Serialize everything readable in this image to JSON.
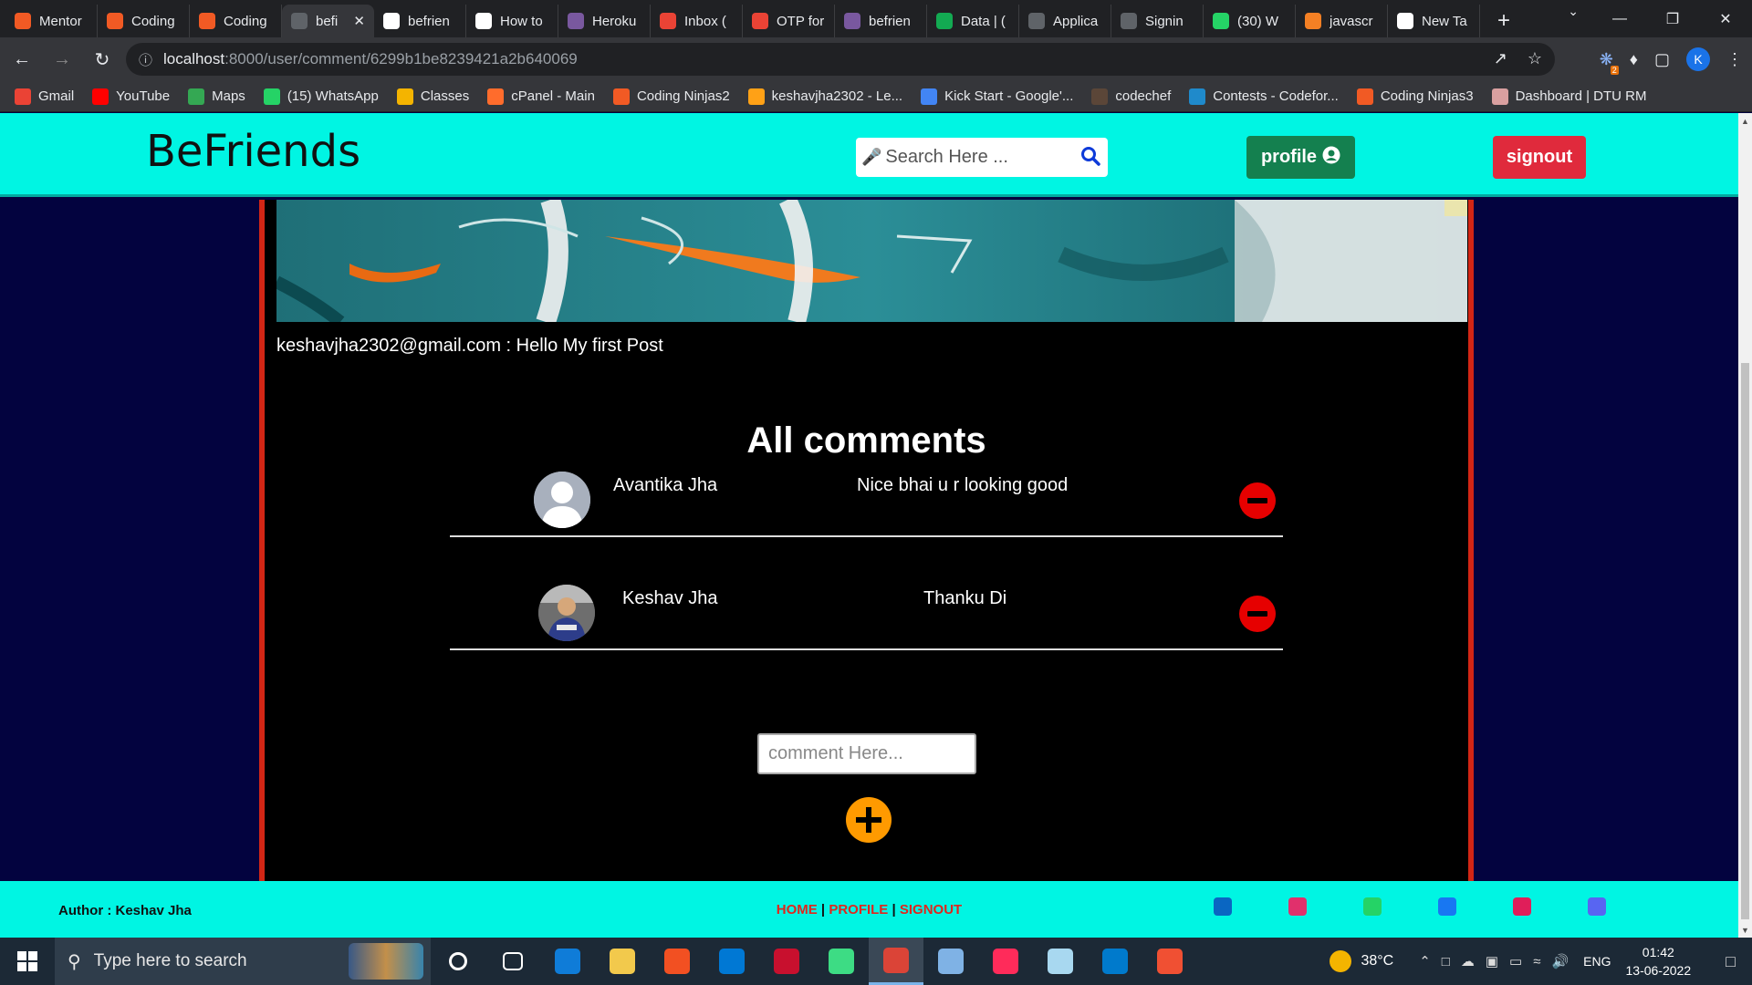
{
  "browser": {
    "tabs": [
      {
        "title": "Mentor",
        "icon": "coding-ninjas-icon",
        "color": "#f15a24"
      },
      {
        "title": "Coding",
        "icon": "coding-ninjas-icon",
        "color": "#f15a24"
      },
      {
        "title": "Coding",
        "icon": "coding-ninjas-icon",
        "color": "#f15a24"
      },
      {
        "title": "befi",
        "icon": "globe-icon",
        "color": "#5f6368",
        "active": true
      },
      {
        "title": "befrien",
        "icon": "github-icon",
        "color": "#ffffff"
      },
      {
        "title": "How to",
        "icon": "medium-icon",
        "color": "#ffffff"
      },
      {
        "title": "Heroku",
        "icon": "heroku-icon",
        "color": "#79589f"
      },
      {
        "title": "Inbox (",
        "icon": "gmail-icon",
        "color": "#ea4335"
      },
      {
        "title": "OTP for",
        "icon": "gmail-icon",
        "color": "#ea4335"
      },
      {
        "title": "befrien",
        "icon": "heroku-icon",
        "color": "#79589f"
      },
      {
        "title": "Data | (",
        "icon": "mongodb-icon",
        "color": "#13aa52"
      },
      {
        "title": "Applica",
        "icon": "globe-icon",
        "color": "#5f6368"
      },
      {
        "title": "Signin",
        "icon": "globe-icon",
        "color": "#5f6368"
      },
      {
        "title": "(30) W",
        "icon": "whatsapp-icon",
        "color": "#25d366"
      },
      {
        "title": "javascr",
        "icon": "stackoverflow-icon",
        "color": "#f48024"
      },
      {
        "title": "New Ta",
        "icon": "chrome-icon",
        "color": "#ffffff"
      }
    ],
    "url_host": "localhost",
    "url_path": ":8000/user/comment/6299b1be8239421a2b640069",
    "profile_initial": "K",
    "extension_badge": "2",
    "bookmarks": [
      {
        "label": "Gmail",
        "icon": "gmail-icon",
        "color": "#ea4335"
      },
      {
        "label": "YouTube",
        "icon": "youtube-icon",
        "color": "#ff0000"
      },
      {
        "label": "Maps",
        "icon": "maps-icon",
        "color": "#34a853"
      },
      {
        "label": "(15) WhatsApp",
        "icon": "whatsapp-icon",
        "color": "#25d366"
      },
      {
        "label": "Classes",
        "icon": "classroom-icon",
        "color": "#f4b400"
      },
      {
        "label": "cPanel - Main",
        "icon": "cpanel-icon",
        "color": "#ff6c2c"
      },
      {
        "label": "Coding Ninjas2",
        "icon": "coding-ninjas-icon",
        "color": "#f15a24"
      },
      {
        "label": "keshavjha2302 - Le...",
        "icon": "leetcode-icon",
        "color": "#ffa116"
      },
      {
        "label": "Kick Start - Google'...",
        "icon": "google-icon",
        "color": "#4285f4"
      },
      {
        "label": "codechef",
        "icon": "codechef-icon",
        "color": "#5b4638"
      },
      {
        "label": "Contests - Codefor...",
        "icon": "codeforces-icon",
        "color": "#1f8acb"
      },
      {
        "label": "Coding Ninjas3",
        "icon": "coding-ninjas-icon",
        "color": "#f15a24"
      },
      {
        "label": "Dashboard | DTU RM",
        "icon": "dtu-icon",
        "color": "#d9a0a0"
      }
    ]
  },
  "site": {
    "brand": "BeFriends",
    "search_placeholder": "Search Here ...",
    "profile_label": "profile",
    "signout_label": "signout",
    "post_caption": "keshavjha2302@gmail.com : Hello My first Post",
    "comments_title": "All comments",
    "comments": [
      {
        "name": "Avantika Jha",
        "text": "Nice bhai u r looking good",
        "avatar": "default-user-avatar"
      },
      {
        "name": "Keshav Jha",
        "text": "Thanku Di",
        "avatar": "user-photo-avatar"
      }
    ],
    "comment_placeholder": "comment Here...",
    "footer_author": "Author : Keshav Jha",
    "footer_links": [
      "HOME",
      "PROFILE",
      "SIGNOUT"
    ],
    "footer_separator": " | ",
    "socials": [
      {
        "icon": "linkedin-icon",
        "color": "#0a66c2"
      },
      {
        "icon": "instagram-icon",
        "color": "#e1306c"
      },
      {
        "icon": "whatsapp-icon",
        "color": "#25d366"
      },
      {
        "icon": "facebook-icon",
        "color": "#1877f2"
      },
      {
        "icon": "slack-icon",
        "color": "#e01e5a"
      },
      {
        "icon": "discord-icon",
        "color": "#5865f2"
      }
    ],
    "colors": {
      "navbar": "#00f5e3",
      "page_bg": "#03033f",
      "card_border": "#d22615",
      "profile_btn": "#14804f",
      "signout_btn": "#e02a3c",
      "delete_btn": "#e60000",
      "add_btn": "#ff9a00"
    }
  },
  "taskbar": {
    "search_placeholder": "Type here to search",
    "apps": [
      {
        "icon": "cortana-icon",
        "color": "#1c2936"
      },
      {
        "icon": "task-view-icon",
        "color": "#1c2936"
      },
      {
        "icon": "edge-icon",
        "color": "#0f7cd8"
      },
      {
        "icon": "file-explorer-icon",
        "color": "#f2c94c"
      },
      {
        "icon": "microsoft-store-icon",
        "color": "#f25022"
      },
      {
        "icon": "mail-icon",
        "color": "#0078d4"
      },
      {
        "icon": "mcafee-icon",
        "color": "#c8102e"
      },
      {
        "icon": "rocket-icon",
        "color": "#3ddc84"
      },
      {
        "icon": "chrome-icon",
        "color": "#db4437",
        "active": true
      },
      {
        "icon": "paint-icon",
        "color": "#7fb2e5"
      },
      {
        "icon": "creative-cloud-icon",
        "color": "#ff2b5a"
      },
      {
        "icon": "notepad-icon",
        "color": "#a8d8f0"
      },
      {
        "icon": "vscode-icon",
        "color": "#007acc"
      },
      {
        "icon": "git-icon",
        "color": "#f05033"
      }
    ],
    "temperature": "38°C",
    "language": "ENG",
    "time": "01:42",
    "date": "13-06-2022"
  }
}
